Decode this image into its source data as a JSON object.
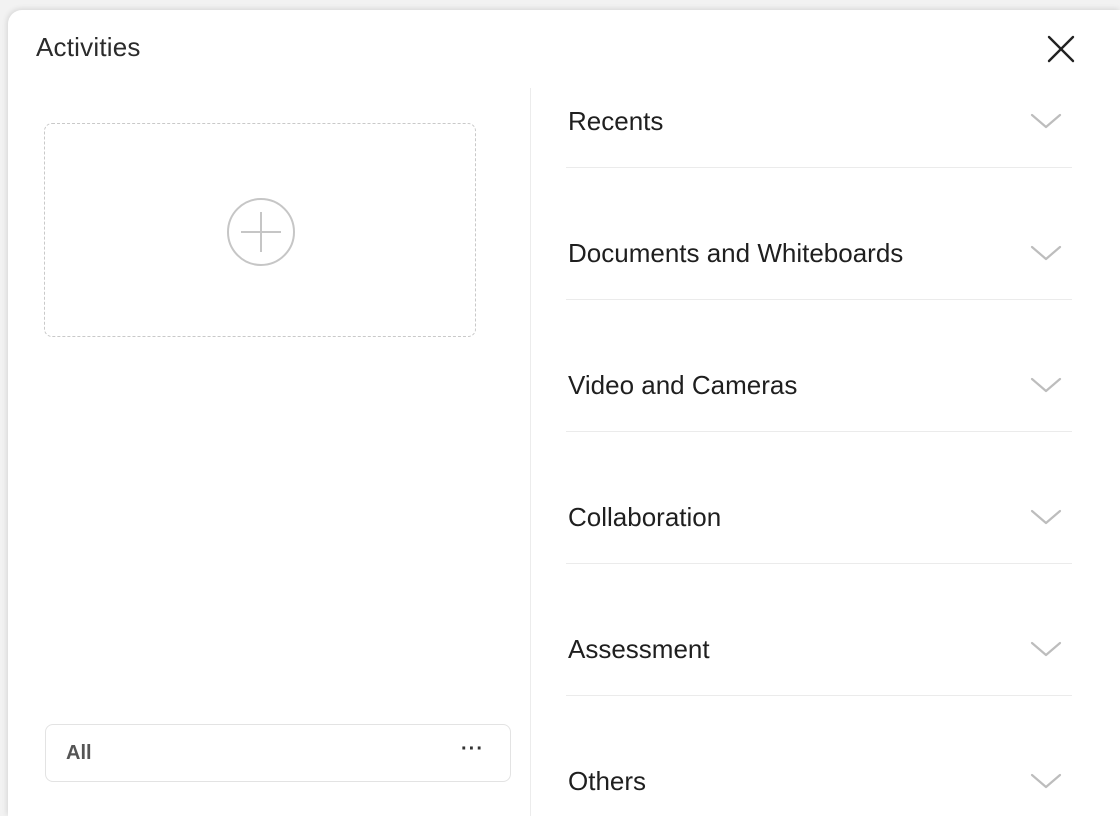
{
  "panel": {
    "title": "Activities"
  },
  "left": {
    "filter_label": "All",
    "filter_more": "···"
  },
  "categories": [
    {
      "label": "Recents"
    },
    {
      "label": "Documents and Whiteboards"
    },
    {
      "label": "Video and Cameras"
    },
    {
      "label": "Collaboration"
    },
    {
      "label": "Assessment"
    },
    {
      "label": "Others"
    }
  ],
  "icons": {
    "close": "close-icon",
    "add": "plus-circle-icon",
    "chevron": "chevron-down-icon",
    "more": "more-horizontal-icon"
  }
}
